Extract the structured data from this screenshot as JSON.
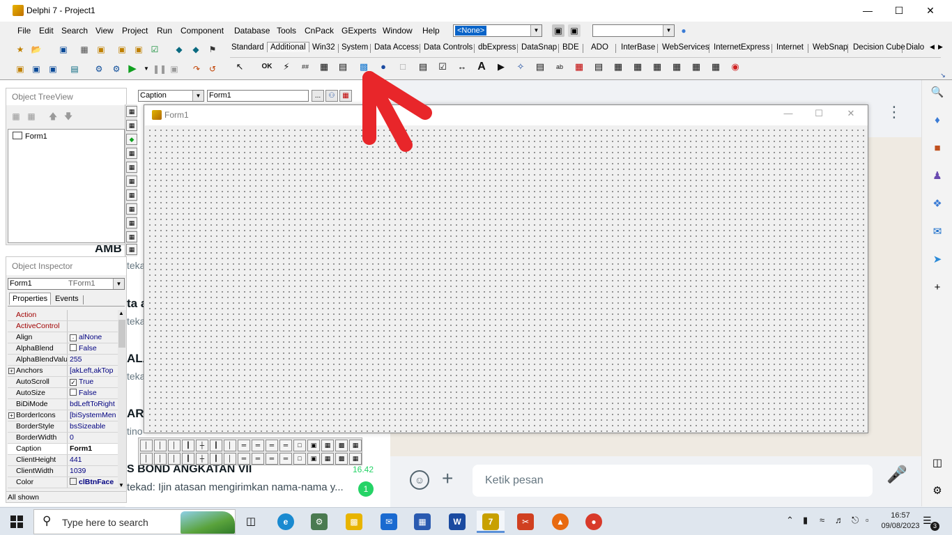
{
  "window": {
    "title": "Delphi 7 - Project1"
  },
  "menu": [
    "File",
    "Edit",
    "Search",
    "View",
    "Project",
    "Run",
    "Component",
    "Database",
    "Tools",
    "CnPack",
    "GExperts",
    "Window",
    "Help"
  ],
  "toolbar": {
    "config_combo": "<None>"
  },
  "palette_tabs": [
    "Standard",
    "Additional",
    "Win32",
    "System",
    "Data Access",
    "Data Controls",
    "dbExpress",
    "DataSnap",
    "BDE",
    "ADO",
    "InterBase",
    "WebServices",
    "InternetExpress",
    "Internet",
    "WebSnap",
    "Decision Cube",
    "Dialo"
  ],
  "palette_active_tab": "Additional",
  "treeview": {
    "title": "Object TreeView",
    "root": "Form1"
  },
  "inspector": {
    "title": "Object Inspector",
    "object_name": "Form1",
    "object_type": "TForm1",
    "tabs": [
      "Properties",
      "Events"
    ],
    "status": "All shown",
    "rows": [
      {
        "key": "Action",
        "value": "",
        "type": "event"
      },
      {
        "key": "ActiveControl",
        "value": "",
        "type": "event"
      },
      {
        "key": "Align",
        "value": "alNone",
        "type": "align"
      },
      {
        "key": "AlphaBlend",
        "value": "False",
        "type": "check"
      },
      {
        "key": "AlphaBlendValu",
        "value": "255",
        "type": "plain"
      },
      {
        "key": "Anchors",
        "value": "[akLeft,akTop",
        "type": "expand"
      },
      {
        "key": "AutoScroll",
        "value": "True",
        "type": "checked"
      },
      {
        "key": "AutoSize",
        "value": "False",
        "type": "check"
      },
      {
        "key": "BiDiMode",
        "value": "bdLeftToRight",
        "type": "plain"
      },
      {
        "key": "BorderIcons",
        "value": "[biSystemMen",
        "type": "expand"
      },
      {
        "key": "BorderStyle",
        "value": "bsSizeable",
        "type": "plain"
      },
      {
        "key": "BorderWidth",
        "value": "0",
        "type": "plain"
      },
      {
        "key": "Caption",
        "value": "Form1",
        "type": "selected"
      },
      {
        "key": "ClientHeight",
        "value": "441",
        "type": "plain"
      },
      {
        "key": "ClientWidth",
        "value": "1039",
        "type": "plain"
      },
      {
        "key": "Color",
        "value": "clBtnFace",
        "type": "color"
      }
    ]
  },
  "property_bar": {
    "property": "Caption",
    "value": "Form1"
  },
  "form": {
    "title": "Form1"
  },
  "background_app": {
    "list_fragments": [
      "AMB",
      "tekad",
      "ta a",
      "tekad",
      "ALA",
      "tekad",
      "ARA",
      "tino"
    ],
    "chat_title": "S BOND ANGKATAN VII",
    "chat_time": "16.42",
    "chat_preview": "tekad: Ijin atasan mengirimkan nama-nama y...",
    "unread": "1",
    "compose_placeholder": "Ketik pesan"
  },
  "taskbar": {
    "search_placeholder": "Type here to search",
    "time": "16:57",
    "date": "09/08/2023",
    "notifications": "3"
  },
  "colors": {
    "selection": "#0a64c8",
    "annotation_arrow": "#e8262a",
    "whatsapp_green": "#25d366"
  }
}
